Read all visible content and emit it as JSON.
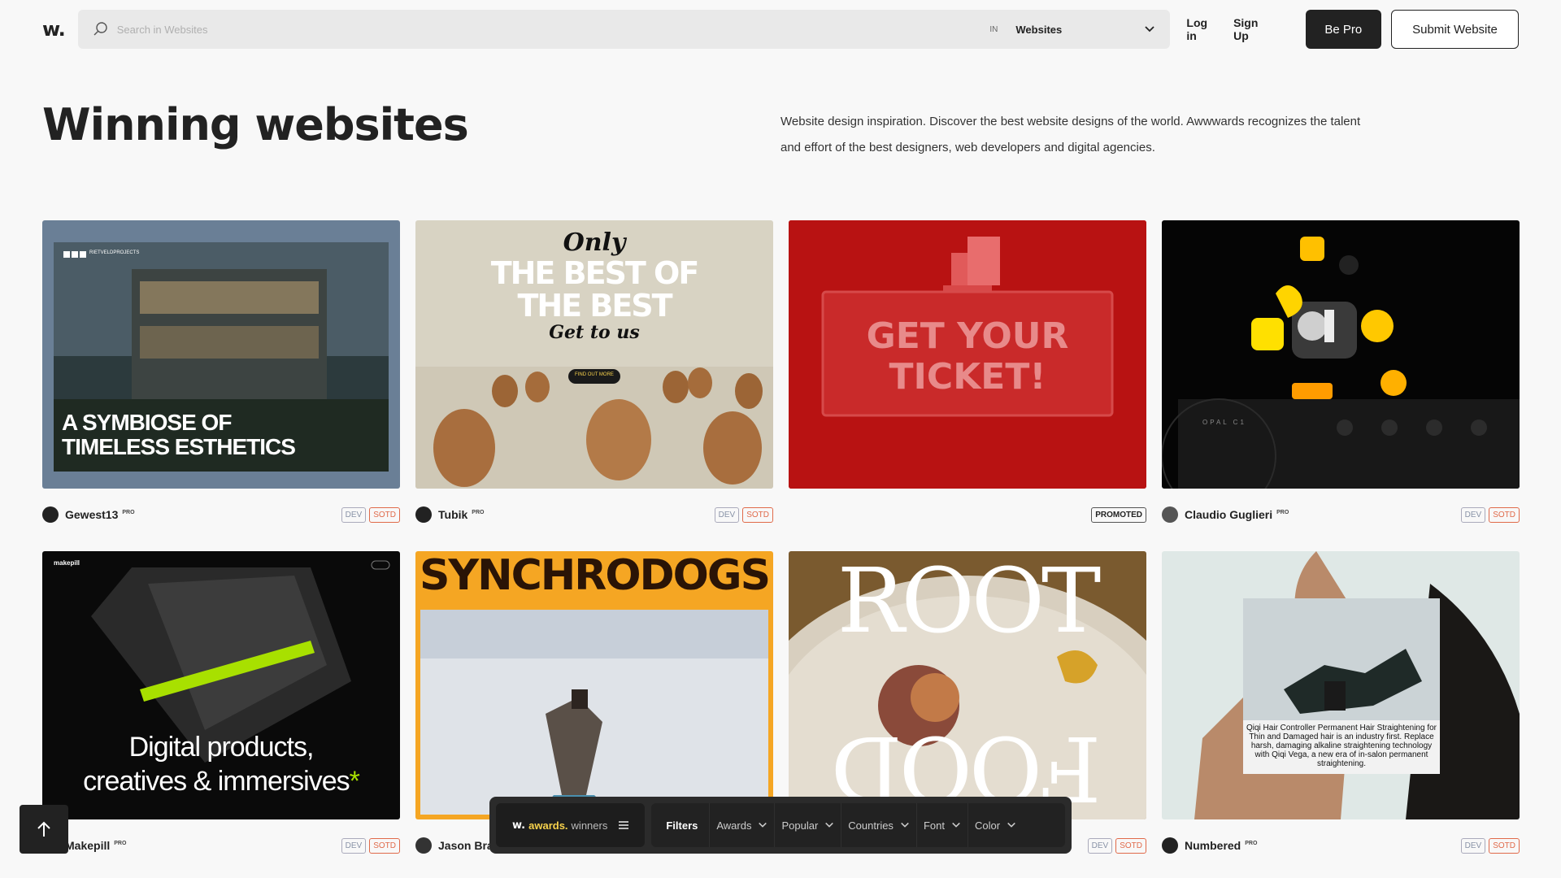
{
  "header": {
    "logo": "w.",
    "search_placeholder": "Search in Websites",
    "in_label": "IN",
    "scope": "Websites",
    "login": "Log in",
    "signup": "Sign Up",
    "be_pro": "Be Pro",
    "submit": "Submit Website"
  },
  "hero": {
    "title": "Winning websites",
    "description": "Website design inspiration. Discover the best website designs of the world. Awwwards recognizes the talent and effort of the best designers, web developers and digital agencies."
  },
  "cards": [
    {
      "name": "Gewest13",
      "pro": "PRO",
      "tags": [
        "DEV",
        "SOTD"
      ],
      "thumb_text": [
        "A SYMBIOSE OF",
        "TIMELESS ESTHETICS"
      ],
      "thumb_small": "RIETVELDPROJECTS"
    },
    {
      "name": "Tubik",
      "pro": "PRO",
      "tags": [
        "DEV",
        "SOTD"
      ],
      "thumb_text": [
        "Only",
        "THE BEST OF",
        "THE BEST",
        "Get to us"
      ],
      "thumb_small": "FIND OUT MORE"
    },
    {
      "name": "",
      "pro": "",
      "tags": [
        "PROMOTED"
      ],
      "thumb_text": [
        "GET YOUR",
        "TICKET!"
      ]
    },
    {
      "name": "Claudio Guglieri",
      "pro": "PRO",
      "tags": [
        "DEV",
        "SOTD"
      ],
      "thumb_text": [
        "OPAL C1"
      ]
    },
    {
      "name": "Makepill",
      "pro": "PRO",
      "tags": [
        "DEV",
        "SOTD"
      ],
      "thumb_text": [
        "Digital products,",
        "creatives & immersives"
      ],
      "thumb_small": "makepill"
    },
    {
      "name": "Jason Bra",
      "pro": "",
      "tags": [],
      "thumb_text": [
        "SYNCHRODOGS"
      ]
    },
    {
      "name": "",
      "pro": "",
      "tags": [
        "DEV",
        "SOTD"
      ],
      "thumb_text": [
        "ROOT",
        "FOOD"
      ]
    },
    {
      "name": "Numbered",
      "pro": "PRO",
      "tags": [
        "DEV",
        "SOTD"
      ],
      "thumb_text": [
        "Qiqi Hair Controller Permanent Hair Straightening for Thin and Damaged hair is an industry first. Replace harsh, damaging alkaline straightening technology with Qiqi Vega, a new era of in-salon permanent straightening."
      ]
    }
  ],
  "filterbar": {
    "brand_w": "w.",
    "brand_awards": "awards.",
    "brand_winners": "winners",
    "filters": "Filters",
    "items": [
      "Awards",
      "Popular",
      "Countries",
      "Font",
      "Color"
    ]
  },
  "colors": {
    "accent": "#f8d24c",
    "sotd": "#e06a4a",
    "dark": "#222222"
  }
}
